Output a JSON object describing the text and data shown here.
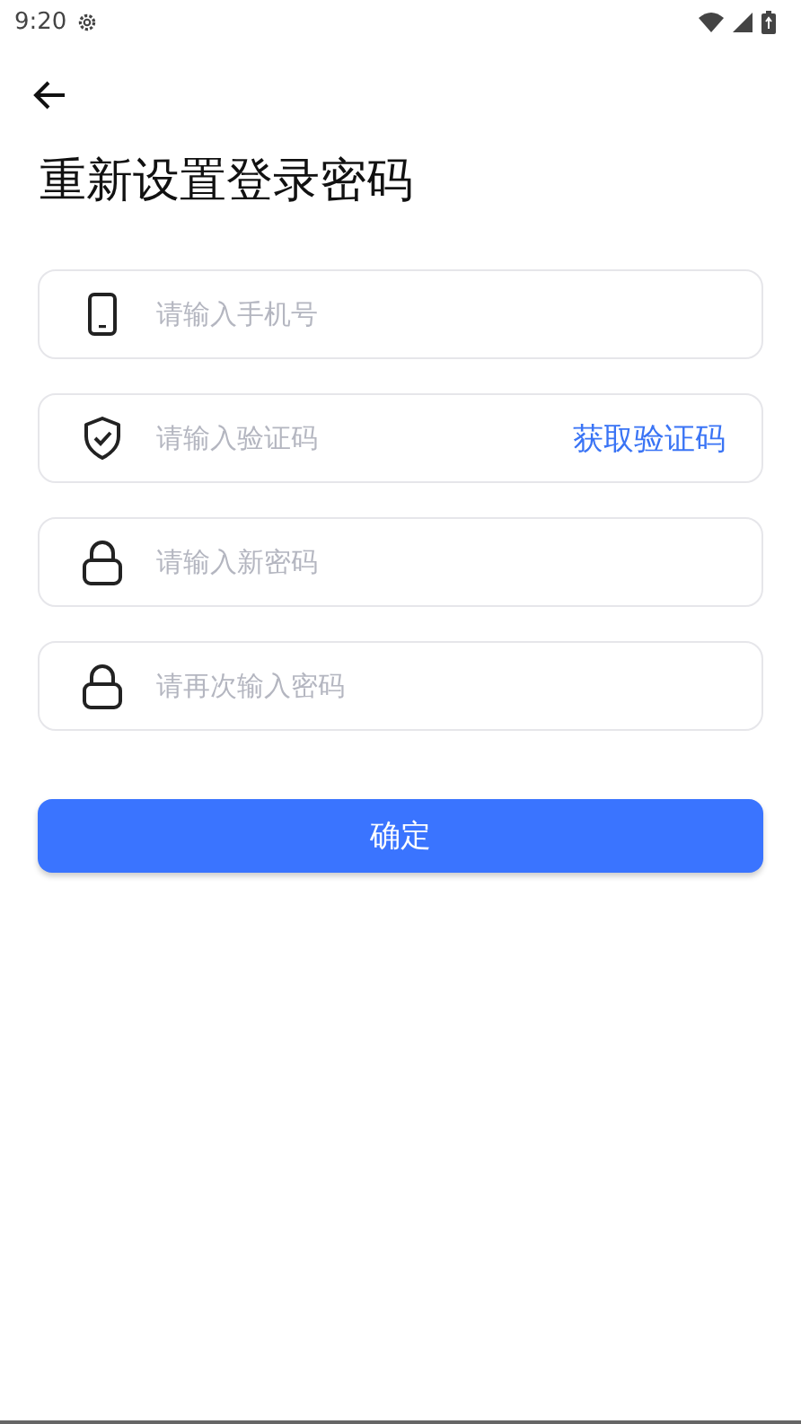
{
  "status_bar": {
    "time": "9:20"
  },
  "title": "重新设置登录密码",
  "fields": [
    {
      "kind": "phone",
      "placeholder": "请输入手机号"
    },
    {
      "kind": "shield",
      "placeholder": "请输入验证码",
      "action": "获取验证码"
    },
    {
      "kind": "lock",
      "placeholder": "请输入新密码"
    },
    {
      "kind": "lock",
      "placeholder": "请再次输入密码"
    }
  ],
  "submit": "确定"
}
